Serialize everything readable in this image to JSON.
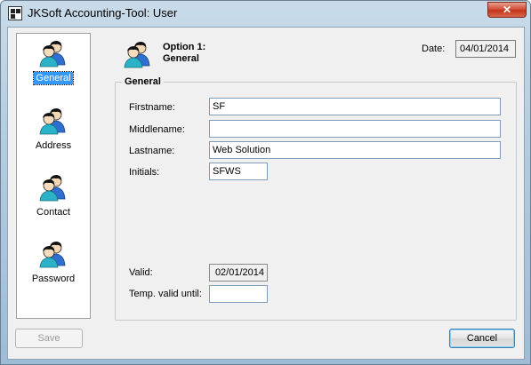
{
  "window": {
    "title": "JKSoft Accounting-Tool: User",
    "close_symbol": "✕"
  },
  "nav": {
    "items": [
      {
        "label": "General",
        "icon": "users-icon",
        "selected": true
      },
      {
        "label": "Address",
        "icon": "users-icon",
        "selected": false
      },
      {
        "label": "Contact",
        "icon": "users-icon",
        "selected": false
      },
      {
        "label": "Password",
        "icon": "users-icon",
        "selected": false
      }
    ]
  },
  "header": {
    "option_line1": "Option 1:",
    "option_line2": "General",
    "date_label": "Date:",
    "date_value": "04/01/2014"
  },
  "general": {
    "legend": "General",
    "firstname_label": "Firstname:",
    "firstname_value": "SF",
    "middlename_label": "Middlename:",
    "middlename_value": "",
    "lastname_label": "Lastname:",
    "lastname_value": "Web Solution",
    "initials_label": "Initials:",
    "initials_value": "SFWS",
    "valid_label": "Valid:",
    "valid_value": "02/01/2014",
    "temp_valid_label": "Temp. valid until:",
    "temp_valid_value": ""
  },
  "buttons": {
    "save": "Save",
    "cancel": "Cancel"
  },
  "colors": {
    "accent": "#3399ff",
    "icon_blue": "#2f6fd0",
    "icon_teal": "#2ab3c8"
  }
}
